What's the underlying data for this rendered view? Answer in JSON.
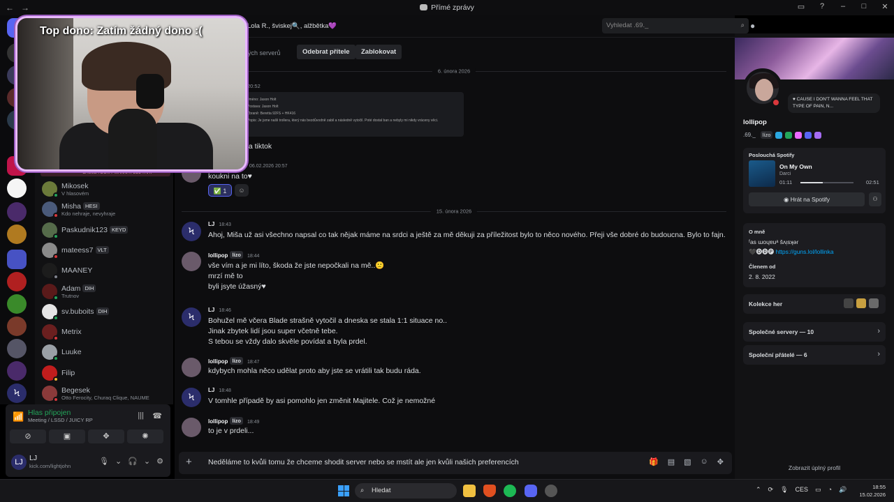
{
  "window": {
    "title": "Přímé zprávy"
  },
  "stream_overlay": {
    "text": "Top dono: Zatím žádný dono :("
  },
  "sidebar": {
    "marquee": "CAUSE I DON'T WANNA FEEL THAT",
    "dms": [
      {
        "name": "Mikosek",
        "tag": "",
        "sub": "V hlasovém",
        "status_color": "#23a55a",
        "avatar_color": "#6b7a3a"
      },
      {
        "name": "Misha",
        "tag": "HESI",
        "sub": "Kdo nehraje, nevyhraje",
        "status_color": "#da373c",
        "avatar_color": "#4a5a7a"
      },
      {
        "name": "Paskudnik123",
        "tag": "KEYD",
        "sub": "",
        "status_color": "#23a55a",
        "avatar_color": "#556b4a"
      },
      {
        "name": "mateess7",
        "tag": "VLT",
        "sub": "",
        "status_color": "#da373c",
        "avatar_color": "#8a8a8a"
      },
      {
        "name": "MAANEY",
        "tag": "",
        "sub": "",
        "status_color": "#80848e",
        "avatar_color": "#1c1c1c"
      },
      {
        "name": "Adam",
        "tag": "DIH",
        "sub": "Trutnov",
        "status_color": "#23a55a",
        "avatar_color": "#5a1a1a"
      },
      {
        "name": "sv.buboits",
        "tag": "DIH",
        "sub": "",
        "status_color": "#23a55a",
        "avatar_color": "#e5e5e5"
      },
      {
        "name": "Metrix",
        "tag": "",
        "sub": "",
        "status_color": "#da373c",
        "avatar_color": "#6a1f1f"
      },
      {
        "name": "Luuke",
        "tag": "",
        "sub": "",
        "status_color": "#23a55a",
        "avatar_color": "#9aa0a6"
      },
      {
        "name": "Filip",
        "tag": "",
        "sub": "",
        "status_color": "#f0b232",
        "avatar_color": "#c01d1d"
      },
      {
        "name": "Begesek",
        "tag": "",
        "sub": "Otto Ferocity, Churaq Clique, NAUME",
        "status_color": "#da373c",
        "avatar_color": "#8a3a3a"
      }
    ]
  },
  "voice": {
    "title": "Hlas připojen",
    "channel": "Meeting / LSSD / JUICY RP"
  },
  "user": {
    "name": "LJ",
    "status": "kick.com/lightjohn",
    "initials": "LJ"
  },
  "header": {
    "names": "Lola R., šviskej🔍, alžbětka💜",
    "search_placeholder": "Vyhledat .69._"
  },
  "actions": {
    "mutual_servers": "ných serverů",
    "remove_friend": "Odebrat přítele",
    "block": "Zablokovat"
  },
  "chat": {
    "date1": "6. února 2026",
    "date2": "15. února 2026",
    "early_time": "20:52",
    "embed_lines": [
      "Jméno: Jason Holt",
      "Postava: Jason Holt",
      "Zbraně: Beretta 92FS + HK416",
      "Popis: Je jsme našli trollera, který nás bezdůvodně zabil a následně vytočil. Poté dostal ban a nebyly mi nikdy vráceny věci."
    ],
    "early_text": "na tiktok",
    "lolli_time1": "06.02.2026 20:57",
    "lolli_text1": "koukni na to♥",
    "reaction_emoji": "✅",
    "reaction_count": "1",
    "messages": [
      {
        "author": "LJ",
        "badge": "",
        "time": "18:43",
        "lines": [
          "Ahoj, Miša už asi všechno napsal co tak nějak máme na srdci a ještě za mě děkuji za příležitost bylo to něco nového. Přeji vše dobré do budoucna. Bylo to fajn."
        ]
      },
      {
        "author": "lollipop",
        "badge": "lízo",
        "time": "18:44",
        "lines": [
          "vše vím a je mi líto, škoda že jste nepočkali na mě..🙁",
          "mrzí mě to",
          "byli jsyte úžasný♥"
        ]
      },
      {
        "author": "LJ",
        "badge": "",
        "time": "18:46",
        "lines": [
          "Bohužel mě včera Blade strašně vytočil a dneska se stala 1:1 situace no..",
          "Jinak zbytek lidí jsou super včetně tebe.",
          "S tebou se vždy dalo skvěle povídat a byla prdel."
        ]
      },
      {
        "author": "lollipop",
        "badge": "lízo",
        "time": "18:47",
        "lines": [
          "kdybych mohla něco udělat proto aby jste se vrátili tak budu ráda."
        ]
      },
      {
        "author": "LJ",
        "badge": "",
        "time": "18:48",
        "lines": [
          "V tomhle případě by asi pomohlo jen změnit Majitele. Což je nemožné"
        ]
      },
      {
        "author": "lollipop",
        "badge": "lízo",
        "time": "18:49",
        "lines": [
          "to je v prdeli..."
        ]
      }
    ],
    "composer_text": "Neděláme to kvůli tomu že chceme shodit server nebo se mstít ale jen kvůli našich preferencích"
  },
  "profile": {
    "status_bubble": "CAUSE I DON'T WANNA FEEL THAT TYPE OF PAIN, N...",
    "display_name": "lollipop",
    "username": ".69._",
    "badge": "lízo",
    "spotify_header": "Poslouchá Spotify",
    "track": "On My Own",
    "artist": "Darci",
    "elapsed": "01:11",
    "duration": "02:51",
    "progress": 0.42,
    "play_button": "Hrát na Spotify",
    "about_header": "O mně",
    "about_line1": "ᶠas ɯoɥɐuᵃ šʌᴉsʞəɾ",
    "about_line2": "🖤🅓🅓🅟",
    "about_link": "https://guns.lol/lollinka",
    "member_since_header": "Členem od",
    "member_since": "2. 8. 2022",
    "collection": "Kolekce her",
    "mutual_servers": "Společné servery — 10",
    "mutual_friends": "Společní přátelé — 6",
    "full_profile": "Zobrazit úplný profil"
  },
  "taskbar": {
    "search": "Hledat",
    "lang": "CES",
    "time": "18:55",
    "date": "15.02.2026"
  },
  "colors": {
    "accent_green": "#23a55a",
    "dnd_red": "#da373c",
    "link_blue": "#00a8fc",
    "cam_border": "#e9b9ff"
  }
}
